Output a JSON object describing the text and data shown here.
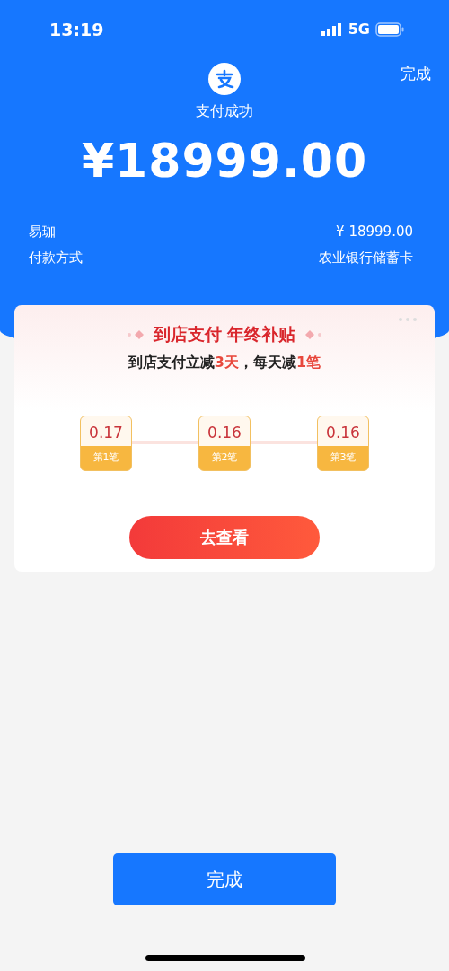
{
  "status_bar": {
    "time": "13:19",
    "network": "5G"
  },
  "header": {
    "done_link": "完成",
    "title": "支付成功",
    "amount": "¥18999.00"
  },
  "details": [
    {
      "label": "易珈",
      "value": "¥ 18999.00"
    },
    {
      "label": "付款方式",
      "value": "农业银行储蓄卡"
    }
  ],
  "promo": {
    "title": "到店支付 年终补贴",
    "subtitle": "到店支付立减**3天**，每天减**1笔**",
    "steps": [
      {
        "amount": "0.17",
        "label": "第1笔"
      },
      {
        "amount": "0.16",
        "label": "第2笔"
      },
      {
        "amount": "0.16",
        "label": "第3笔"
      }
    ],
    "button": "去查看"
  },
  "done_button": "完成"
}
